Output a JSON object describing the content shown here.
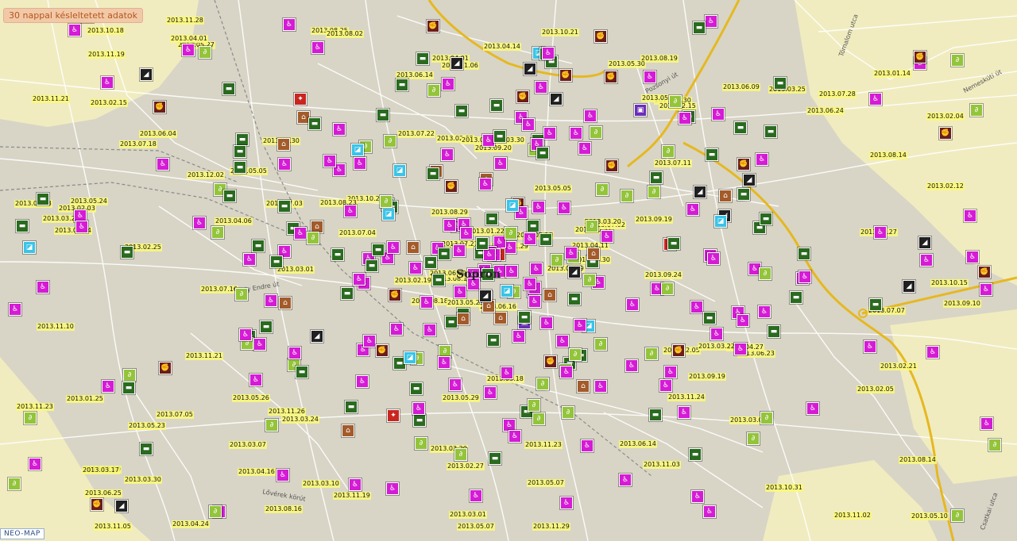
{
  "notice": "30 nappal késleltetett adatok",
  "logo": "NEO-MAP",
  "city": "Sopron",
  "streets": [
    "Ady Endre út",
    "Pozsonyi út",
    "Nemeskúti út",
    "Lővérek körút",
    "Tómalom utca",
    "Csatkai utca"
  ],
  "dates": [
    "2013.06.16",
    "2013.07.18",
    "2013.08.14",
    "2013.02.10",
    "2013.05.31",
    "2013.03.24",
    "2013.08.19",
    "2013.03.30",
    "2013.07.30",
    "2013.06.29",
    "2013.05.27",
    "2013.05.10",
    "2013.02.25",
    "2013.02.04",
    "2013.08.18",
    "2013.07.11",
    "2013.04.24",
    "2013.02.02",
    "2013.05.05",
    "2013.07.05",
    "2013.10.29",
    "2013.06.25",
    "2013.04.16",
    "2013.07.11",
    "2013.07.02",
    "2013.06.23",
    "2013.06.04",
    "2013.11.06",
    "2013.07.24",
    "2013.12.05",
    "2013.02.12",
    "2013.06.09",
    "2013.03.20",
    "2013.07.27",
    "2013.01.30",
    "2013.06.09",
    "2013.11.26",
    "2013.11.02",
    "2013.08.14",
    "2013.04.27",
    "2013.10.21",
    "2013.08.23",
    "2013.04.06",
    "2013.11.24",
    "2013.08.16",
    "2013.05.13",
    "2013.04.11",
    "2013.11.05",
    "2013.02.27",
    "2013.03.30",
    "2013.05.23",
    "2013.08.14",
    "2013.11.21",
    "2013.09.19",
    "2013.11.03",
    "2013.03.07",
    "2013.04.01",
    "2013.10.18",
    "2013.11.23",
    "2013.07.28",
    "2013.04.14",
    "2013.03.01",
    "2013.05.24",
    "2013.05.05",
    "2013.03.25",
    "2013.11.28",
    "2013.05.30",
    "2013.06.14",
    "2013.01.22",
    "2013.11.23",
    "2013.05.29",
    "2013.11.19",
    "2013.03.22",
    "2013.07.03",
    "2013.03.17",
    "2013.11.19",
    "2013.12.02",
    "2013.11.10",
    "2013.08.29",
    "2013.05.07",
    "2013.05.19",
    "2013.03.30",
    "2013.09.24",
    "2013.02.21",
    "2013.03.01",
    "2013.09.27",
    "2013.03.18",
    "2013.10.31",
    "2013.11.29",
    "2013.06.14",
    "2013.04.01",
    "2013.09.10",
    "2013.09.19",
    "2013.03.07",
    "2013.11.29",
    "2013.02.05",
    "2013.02.03",
    "2013.05.07",
    "2013.05.21",
    "2013.02.15",
    "2013.07.16",
    "2013.08.25",
    "2013.10.15",
    "2013.03.29",
    "2013.11.21",
    "2013.05.26",
    "2013.03.10",
    "2013.03.20",
    "2013.06.24",
    "2013.07.04",
    "2013.07.07",
    "2013.02.15",
    "2013.09.20",
    "2013.02.19",
    "2013.08.02",
    "2013.01.25",
    "2013.05.27",
    "2013.01.14",
    "2013.07.22"
  ],
  "colors": {
    "land": "#d8d5c6",
    "field": "#f0ecc0",
    "road": "#ffffff",
    "highway": "#e6b820",
    "rail": "#8a8a8a"
  }
}
